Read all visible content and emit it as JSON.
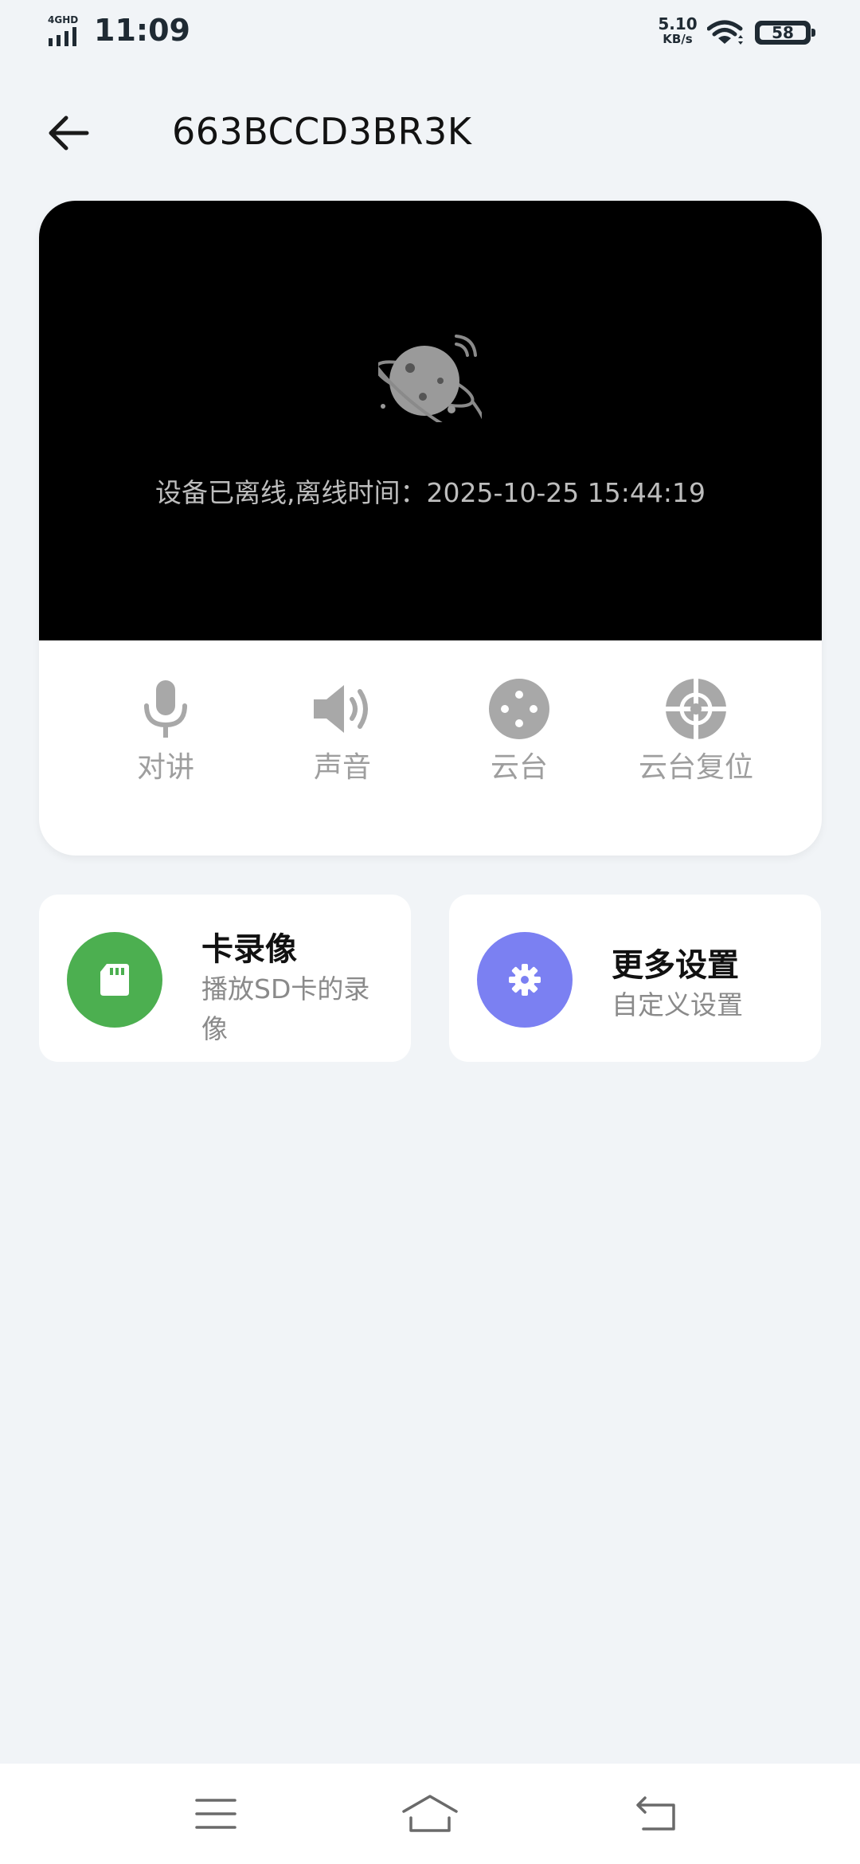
{
  "status_bar": {
    "network_type": "4GHD",
    "time": "11:09",
    "speed_value": "5.10",
    "speed_unit": "KB/s",
    "battery": "58"
  },
  "header": {
    "title": "663BCCD3BR3K"
  },
  "video": {
    "offline_text": "设备已离线,离线时间：2025-10-25 15:44:19"
  },
  "controls": [
    {
      "label": "对讲",
      "icon": "microphone-icon"
    },
    {
      "label": "声音",
      "icon": "speaker-icon"
    },
    {
      "label": "云台",
      "icon": "ptz-joystick-icon"
    },
    {
      "label": "云台复位",
      "icon": "ptz-reset-icon"
    }
  ],
  "cards": {
    "sd": {
      "title": "卡录像",
      "subtitle": "播放SD卡的录像",
      "icon": "sd-card-icon",
      "color": "#4caf50"
    },
    "settings": {
      "title": "更多设置",
      "subtitle": "自定义设置",
      "icon": "gear-icon",
      "color": "#7b80f2"
    }
  },
  "nav": {
    "icons": [
      "menu-icon",
      "home-icon",
      "back-icon"
    ]
  },
  "colors": {
    "background": "#f1f4f7",
    "control_gray": "#a8a8a8",
    "video_bg": "#000000"
  }
}
